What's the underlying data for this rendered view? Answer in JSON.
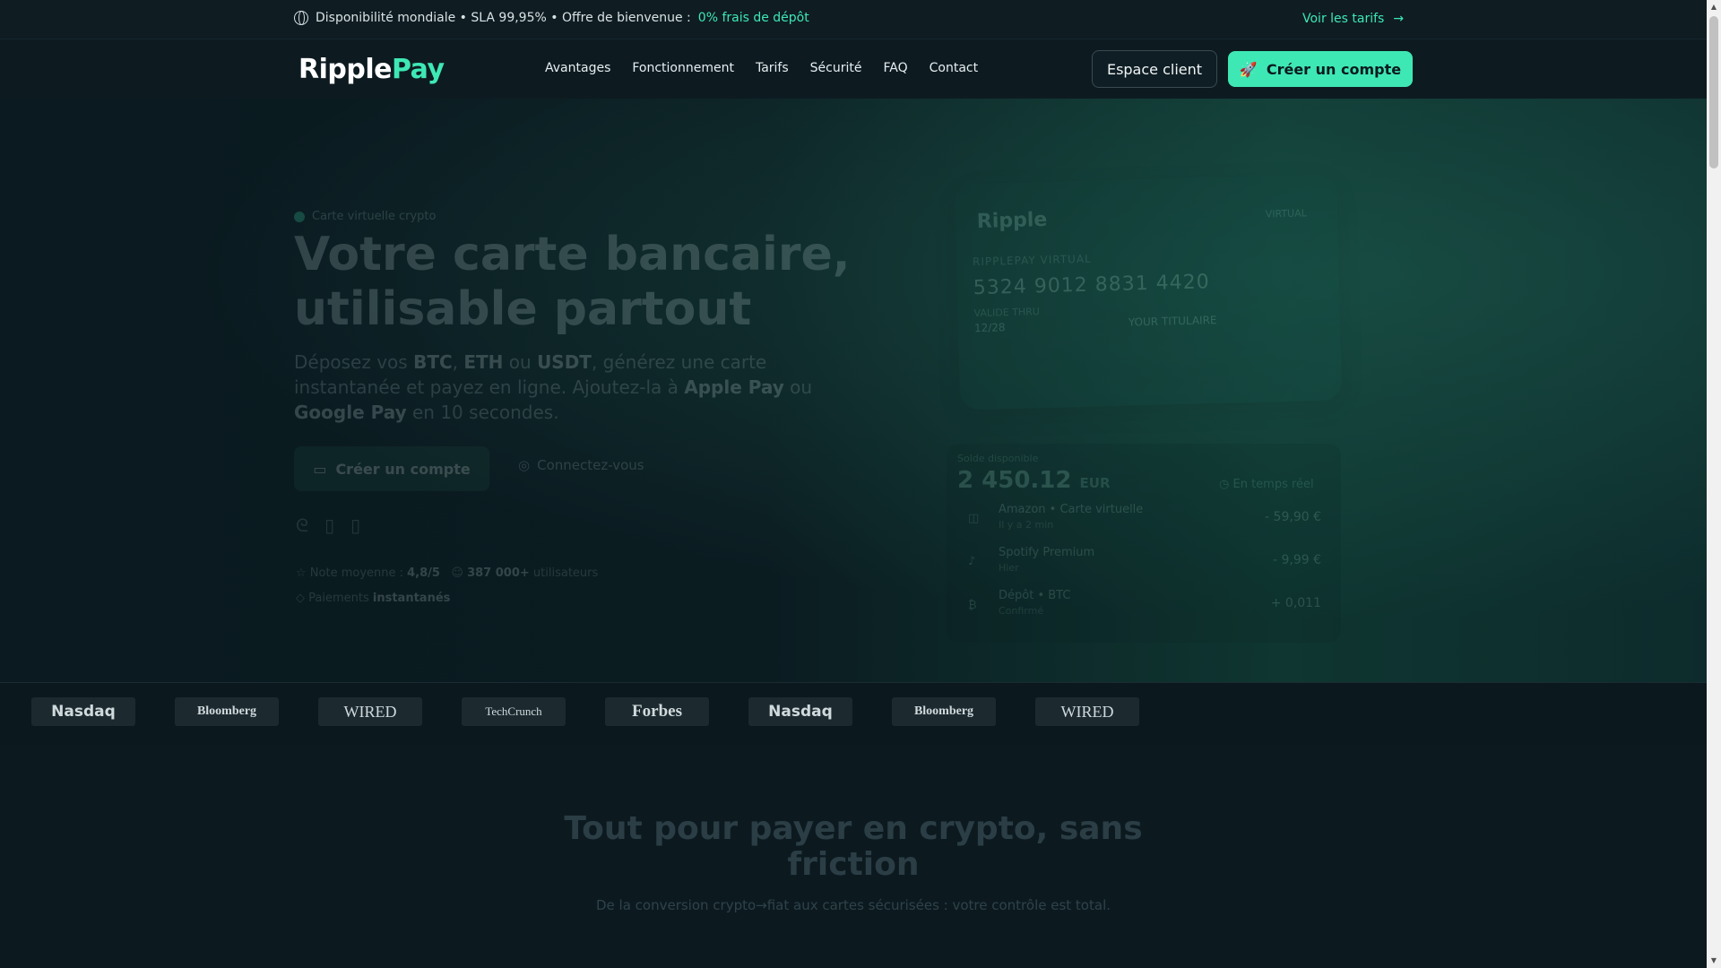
{
  "topbar": {
    "announcement_prefix": "Disponibilité mondiale • SLA 99,95% • Offre de bienvenue :",
    "announcement_highlight": "0% frais de dépôt",
    "pricing_link": "Voir les tarifs",
    "accent_color": "#3ee8b5"
  },
  "nav": {
    "logo_part1": "Ripple",
    "logo_part2": "Pay",
    "links": [
      "Avantages",
      "Fonctionnement",
      "Tarifs",
      "Sécurité",
      "FAQ",
      "Contact"
    ],
    "client_button": "Espace client",
    "signup_button": "Créer un compte"
  },
  "hero": {
    "badge": "Carte virtuelle crypto",
    "title": "Votre carte bancaire, utilisable partout",
    "subtitle_parts": [
      "Déposez vos ",
      "BTC",
      ", ",
      "ETH",
      " ou ",
      "USDT",
      ", générez une carte instantanée et payez en ligne. Ajoutez-la à ",
      "Apple Pay",
      " ou ",
      "Google Pay",
      " en 10 secondes."
    ],
    "cta_primary": "Créer un compte",
    "cta_secondary": "Connectez-vous",
    "rating_label": "Note moyenne :",
    "rating_value": "4,8/5",
    "users_value": "387 000+",
    "users_label": "utilisateurs",
    "payments_label": "Paiements",
    "payments_value": "instantanés"
  },
  "card": {
    "brand": "Ripple",
    "tag": "VIRTUAL",
    "label": "RIPPLEPAY VIRTUAL",
    "number": "5324 9012 8831 4420",
    "expiry_label": "VALIDE THRU",
    "expiry": "12/28",
    "holder": "YOUR TITULAIRE"
  },
  "transactions": {
    "balance_label": "Solde disponible",
    "balance": "2 450.12",
    "currency": "EUR",
    "live_label": "En temps réel",
    "rows": [
      {
        "icon": "cart-icon",
        "title": "Amazon • Carte virtuelle",
        "sub": "Il y a 2 min",
        "amount": "- 59,90 €"
      },
      {
        "icon": "music-icon",
        "title": "Spotify Premium",
        "sub": "Hier",
        "amount": "- 9,99 €"
      },
      {
        "icon": "bitcoin-icon",
        "title": "Dépôt • BTC",
        "sub": "Confirmé",
        "amount": "+ 0,011"
      }
    ]
  },
  "press": [
    "Nasdaq",
    "Bloomberg",
    "WIRED",
    "TechCrunch",
    "Forbes",
    "Nasdaq",
    "Bloomberg",
    "WIRED"
  ],
  "features": {
    "title": "Tout pour payer en crypto, sans friction",
    "subtitle": "De la conversion crypto→fiat aux cartes sécurisées : votre contrôle est total."
  }
}
